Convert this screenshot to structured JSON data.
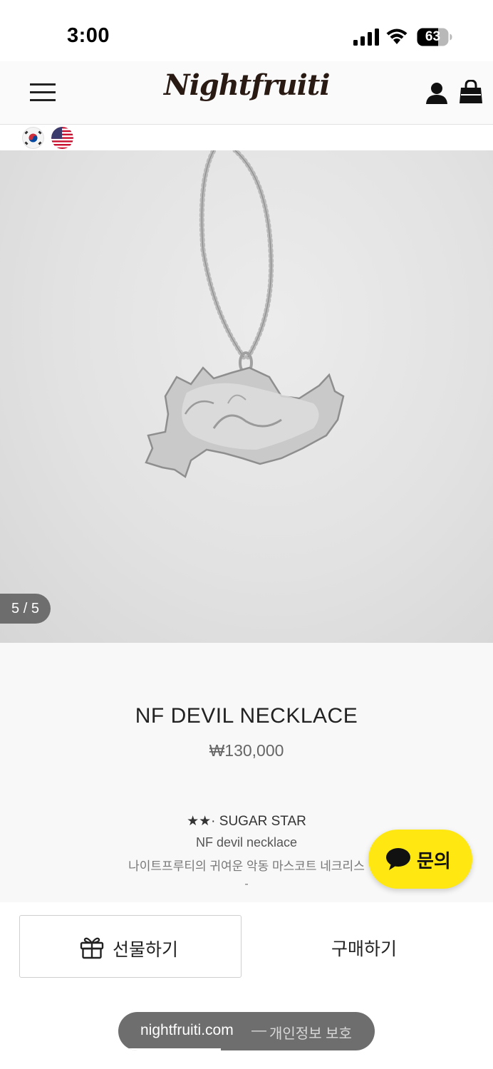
{
  "status_bar": {
    "time": "3:00",
    "battery": "63",
    "signal_icon": "cellular-signal-icon",
    "wifi_icon": "wifi-icon",
    "battery_icon": "battery-icon"
  },
  "header": {
    "brand": "Nightfruiti",
    "menu_icon": "hamburger-menu-icon",
    "user_icon": "user-account-icon",
    "bag_icon": "shopping-bag-icon"
  },
  "languages": [
    {
      "icon": "korea-flag-icon"
    },
    {
      "icon": "usa-flag-icon"
    }
  ],
  "gallery": {
    "counter": "5 / 5",
    "current": 5,
    "total": 5
  },
  "product": {
    "name": "NF DEVIL NECKLACE",
    "price": "₩130,000",
    "desc_title": "★★· SUGAR STAR",
    "desc_line1": "NF devil necklace",
    "desc_line2": "나이트프루티의 귀여운 악동 마스코트 네크리스",
    "desc_dash": "-"
  },
  "chat": {
    "label": "문의",
    "icon": "chat-bubble-icon",
    "color": "#ffe812"
  },
  "actions": {
    "gift_label": "선물하기",
    "gift_icon": "gift-box-icon",
    "buy_label": "구매하기"
  },
  "browser": {
    "domain": "nightfruiti.com",
    "separator": "—",
    "privacy_label": "개인정보 보호"
  }
}
